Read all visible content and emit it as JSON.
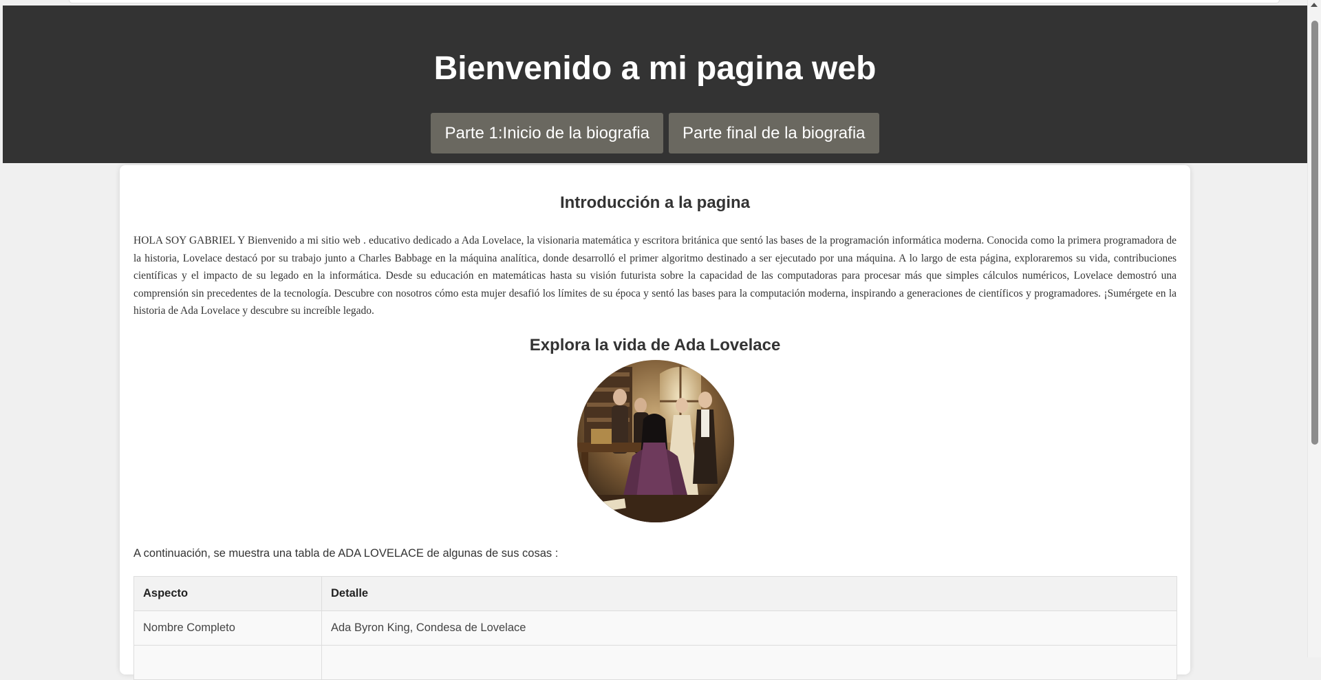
{
  "header": {
    "title": "Bienvenido a mi pagina web",
    "nav": [
      {
        "label": "Parte 1:Inicio de la biografia"
      },
      {
        "label": "Parte final de la biografia"
      }
    ]
  },
  "intro": {
    "title": "Introducción a la pagina",
    "text": "HOLA SOY GABRIEL Y Bienvenido a mi sitio web . educativo dedicado a Ada Lovelace, la visionaria matemática y escritora británica que sentó las bases de la programación informática moderna. Conocida como la primera programadora de la historia, Lovelace destacó por su trabajo junto a Charles Babbage en la máquina analítica, donde desarrolló el primer algoritmo destinado a ser ejecutado por una máquina. A lo largo de esta página, exploraremos su vida, contribuciones científicas y el impacto de su legado en la informática. Desde su educación en matemáticas hasta su visión futurista sobre la capacidad de las computadoras para procesar más que simples cálculos numéricos, Lovelace demostró una comprensión sin precedentes de la tecnología. Descubre con nosotros cómo esta mujer desafió los límites de su época y sentó las bases para la computación moderna, inspirando a generaciones de científicos y programadores. ¡Sumérgete en la historia de Ada Lovelace y descubre su increíble legado."
  },
  "explore": {
    "title": "Explora la vida de Ada Lovelace"
  },
  "table_section": {
    "intro": "A continuación, se muestra una tabla de ADA LOVELACE de algunas de sus cosas :",
    "headers": [
      "Aspecto",
      "Detalle"
    ],
    "rows": [
      [
        "Nombre Completo",
        "Ada Byron King, Condesa de Lovelace"
      ],
      [
        "",
        ""
      ]
    ]
  },
  "colors": {
    "header_bg": "#333333",
    "nav_button_bg": "#6a6860",
    "page_bg": "#f0f0f0",
    "card_bg": "#ffffff"
  }
}
